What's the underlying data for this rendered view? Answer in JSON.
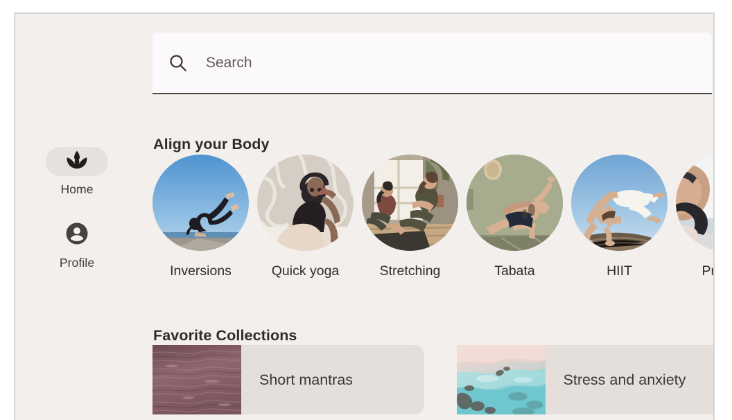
{
  "app": {
    "background_color": "#f2efec"
  },
  "sidebar": {
    "items": [
      {
        "id": "home",
        "label": "Home",
        "icon": "lotus-icon",
        "active": true
      },
      {
        "id": "profile",
        "label": "Profile",
        "icon": "person-icon",
        "active": false
      }
    ]
  },
  "search": {
    "icon": "search-icon",
    "placeholder": "Search",
    "value": ""
  },
  "sections": {
    "align_body": {
      "title": "Align your Body",
      "items": [
        {
          "label": "Inversions",
          "image": "woman-handstand-by-the-sea"
        },
        {
          "label": "Quick yoga",
          "image": "woman-seated-twist-outdoors"
        },
        {
          "label": "Stretching",
          "image": "two-women-stretching-in-studio"
        },
        {
          "label": "Tabata",
          "image": "man-side-plank-green-wall"
        },
        {
          "label": "HIIT",
          "image": "man-backbend-on-log-blue-sky"
        },
        {
          "label": "Pre-nat",
          "image": "pregnant-woman-stretching"
        }
      ]
    },
    "favorite_collections": {
      "title": "Favorite Collections",
      "items": [
        {
          "label": "Short mantras",
          "image": "dusty-purple-water-texture"
        },
        {
          "label": "Stress and anxiety",
          "image": "turquoise-beach-aerial"
        }
      ]
    }
  },
  "colors": {
    "app_background": "#f2efec",
    "surface": "#fbf9fb",
    "card": "#e4dfdb",
    "active_pill": "#e7e1dd",
    "text_primary": "#2f2c2a",
    "text_secondary": "#5c5856",
    "border": "#4a4644"
  }
}
